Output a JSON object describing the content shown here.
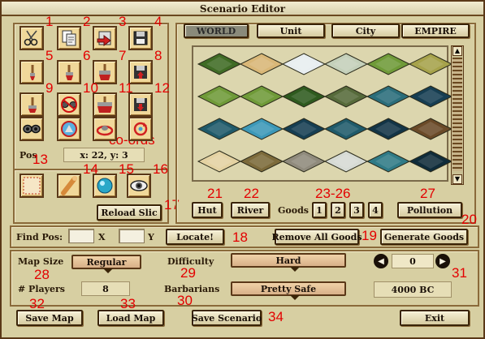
{
  "window": {
    "title": "Scenario Editor"
  },
  "tools": [
    {
      "num": "1",
      "icon": "scissors-icon"
    },
    {
      "num": "2",
      "icon": "copy-document-icon"
    },
    {
      "num": "3",
      "icon": "paste-document-icon"
    },
    {
      "num": "4",
      "icon": "save-disk-icon"
    },
    {
      "num": "5",
      "icon": "small-brush-icon"
    },
    {
      "num": "6",
      "icon": "medium-brush-icon"
    },
    {
      "num": "7",
      "icon": "large-brush-icon"
    },
    {
      "num": "8",
      "icon": "disk-up-icon"
    },
    {
      "num": "9",
      "icon": "brush-icon"
    },
    {
      "num": "10",
      "icon": "no-eyes-icon"
    },
    {
      "num": "11",
      "icon": "wide-brush-icon"
    },
    {
      "num": "12",
      "icon": "disk-arrow-icon"
    },
    {
      "num": "",
      "icon": "eyes-icon"
    },
    {
      "num": "",
      "icon": "pyramid-lens-icon"
    },
    {
      "num": "",
      "icon": "ring-cursor-icon"
    },
    {
      "num": "",
      "icon": "rotate-cursor-icon"
    }
  ],
  "coords": {
    "label": "co-ords",
    "pos_label": "Pos",
    "value": "x: 22, y: 3",
    "num": "13"
  },
  "tools2": [
    {
      "icon": "selection-box-icon"
    },
    {
      "num": "14",
      "icon": "log-icon"
    },
    {
      "num": "15",
      "icon": "crystal-orb-icon"
    },
    {
      "num": "16",
      "icon": "eye-icon"
    }
  ],
  "reload": {
    "label": "Reload Slic",
    "num": "17"
  },
  "tabs": [
    "WORLD",
    "Unit",
    "City",
    "EMPIRE"
  ],
  "terrain_rows": [
    [
      "forest",
      "desert",
      "snow",
      "tundra",
      "grassland",
      "plains"
    ],
    [
      "grassland",
      "grassland",
      "jungle",
      "swamp",
      "ocean-shallow",
      "ocean-deep"
    ],
    [
      "ocean",
      "oasis",
      "ocean-deep",
      "ocean",
      "ocean-dark",
      "dirt"
    ],
    [
      "sand",
      "hills",
      "mountains",
      "plains-glacier",
      "shelf",
      "deep-trench"
    ]
  ],
  "terrain_colors": {
    "forest": "#3f6b24",
    "desert": "#d9b777",
    "snow": "#e8eef0",
    "tundra": "#c4d0ba",
    "grassland": "#6f9a38",
    "plains": "#a6a24a",
    "jungle": "#2e5a1e",
    "swamp": "#566a3a",
    "ocean-shallow": "#2a6d7a",
    "ocean-deep": "#163e52",
    "ocean": "#1f5a6a",
    "oasis": "#3c98b8",
    "ocean-dark": "#123446",
    "dirt": "#6a4a28",
    "sand": "#e4d2a2",
    "hills": "#7c6a3a",
    "mountains": "#8f8a7c",
    "plains-glacier": "#d6dad4",
    "shelf": "#2f7a86",
    "deep-trench": "#0f2c3a"
  },
  "row_buttons": [
    {
      "label": "Hut",
      "num": "21"
    },
    {
      "label": "River",
      "num": "22"
    }
  ],
  "goods": {
    "label": "Goods",
    "options": [
      "1",
      "2",
      "3",
      "4"
    ],
    "num": "23-26"
  },
  "pollution": {
    "label": "Pollution",
    "num": "27"
  },
  "generate": {
    "label": "Generate Goods",
    "num": "20"
  },
  "find": {
    "label": "Find Pos:",
    "x_label": "X",
    "y_label": "Y",
    "x_value": "",
    "y_value": "",
    "locate": "Locate!",
    "locate_num": "18",
    "remove_goods": "Remove All Goods",
    "remove_num": "19"
  },
  "settings": {
    "map_size_label": "Map Size",
    "map_size_num": "28",
    "map_size_value": "Regular",
    "difficulty_label": "Difficulty",
    "difficulty_num": "29",
    "difficulty_value": "Hard",
    "players_label": "# Players",
    "players_value": "8",
    "barbarians_label": "Barbarians",
    "barbarians_num": "30",
    "barbarians_value": "Pretty Safe",
    "year_value": "0",
    "year_num": "31",
    "date_value": "4000 BC"
  },
  "bottom": {
    "save_map": "Save Map",
    "save_map_num": "32",
    "load_map": "Load Map",
    "load_map_num": "33",
    "save_scenario": "Save Scenario",
    "save_scenario_num": "34",
    "exit": "Exit"
  }
}
